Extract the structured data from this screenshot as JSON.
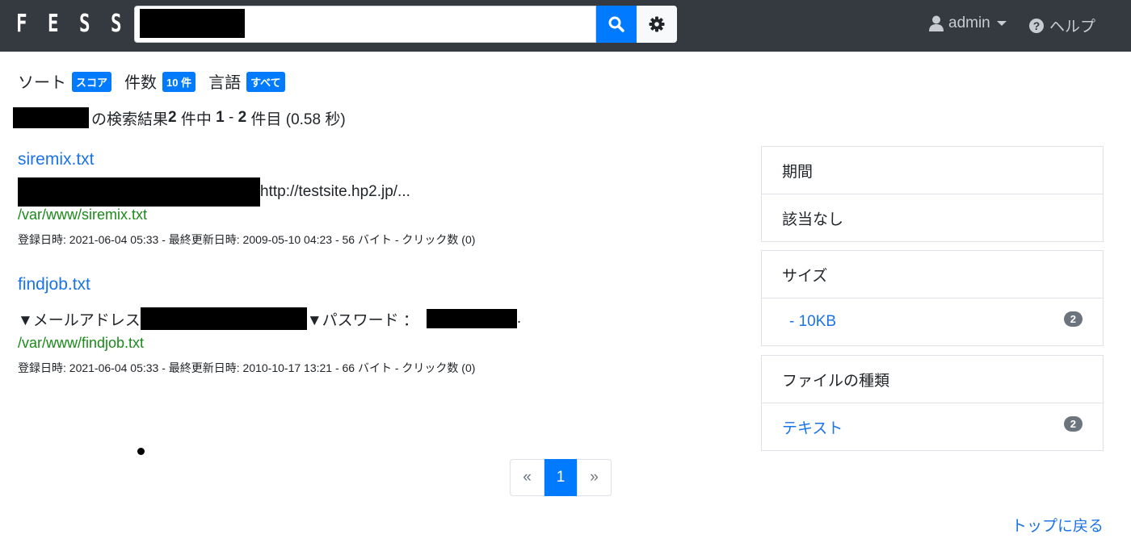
{
  "header": {
    "logo_letters": [
      "F",
      "E",
      "S",
      "S"
    ],
    "search_value": "",
    "user_label": "admin",
    "help_label": "ヘルプ"
  },
  "options": {
    "sort_label": "ソート",
    "sort_value": "スコア",
    "count_label": "件数",
    "count_value": "10 件",
    "lang_label": "言語",
    "lang_value": "すべて"
  },
  "summary": {
    "prefix": "の検索結果 ",
    "total": "2",
    "mid1": " 件中 ",
    "start": "1",
    "dash": " - ",
    "end": "2",
    "suffix": " 件目 (0.58 秒)"
  },
  "results": [
    {
      "title": "siremix.txt",
      "snippet_tail": "http://testsite.hp2.jp/...",
      "url": "/var/www/siremix.txt",
      "meta": "登録日時: 2021-06-04 05:33 - 最終更新日時: 2009-05-10 04:23 - 56 バイト - クリック数 (0)"
    },
    {
      "title": "findjob.txt",
      "snippet_a": "▼メールアドレス",
      "snippet_b": "▼パスワード ：",
      "snippet_c": ".",
      "url": "/var/www/findjob.txt",
      "meta": "登録日時: 2021-06-04 05:33 - 最終更新日時: 2010-10-17 13:21 - 66 バイト - クリック数 (0)"
    }
  ],
  "pagination": {
    "prev": "«",
    "current": "1",
    "next": "»"
  },
  "facets": {
    "period": {
      "title": "期間",
      "item": "該当なし"
    },
    "size": {
      "title": "サイズ",
      "item": "- 10KB",
      "count": "2"
    },
    "filetype": {
      "title": "ファイルの種類",
      "item": "テキスト",
      "count": "2"
    }
  },
  "footer": {
    "back_to_top": "トップに戻る"
  },
  "colors": {
    "navbar": "#343a40",
    "accent": "#007bff",
    "link": "#1a73e8",
    "url": "#1a8a1a"
  }
}
